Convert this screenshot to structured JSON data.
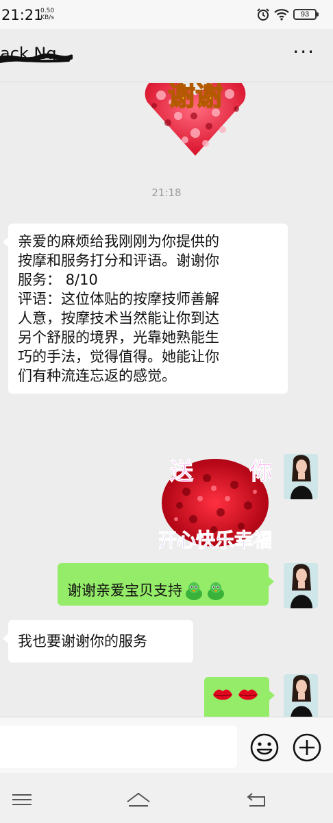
{
  "status_bar": {
    "time": "21:21",
    "net_speed_value": "0.50",
    "net_speed_unit": "KB/s",
    "battery": "93"
  },
  "header": {
    "title": "ack Ng",
    "more_label": "···"
  },
  "messages": {
    "sticker_thanks": {
      "text": "谢谢"
    },
    "timestamp": "21:18",
    "msg1": {
      "text": "亲爱的麻烦给我刚刚为你提供的\n按摩和服务打分和评语。谢谢你\n服务： 8/10\n评语：这位体贴的按摩技师善解\n人意，按摩技术当然能让你到达\n另个舒服的境界，光靠她熟能生\n巧的手法，觉得值得。她能让你\n们有种流连忘返的感觉。"
    },
    "sticker_roses": {
      "top_left": "送",
      "top_right": "你",
      "bottom": "开心快乐幸福"
    },
    "msg3": {
      "text": "谢谢亲爱宝贝支持"
    },
    "msg4": {
      "text": "我也要谢谢你的服务"
    }
  },
  "colors": {
    "chat_bg": "#ededed",
    "bubble_sent": "#95ec69",
    "bubble_received": "#ffffff",
    "timestamp": "#9a9a9a"
  },
  "icons": {
    "status": [
      "alarm-icon",
      "wifi-icon",
      "battery-icon"
    ],
    "input": [
      "emoji-icon",
      "plus-icon"
    ],
    "nav": [
      "menu-icon",
      "home-icon",
      "back-icon"
    ],
    "emoji_in_msg3": "green-bird-emoji",
    "emoji_in_msg5": "lips-emoji"
  }
}
